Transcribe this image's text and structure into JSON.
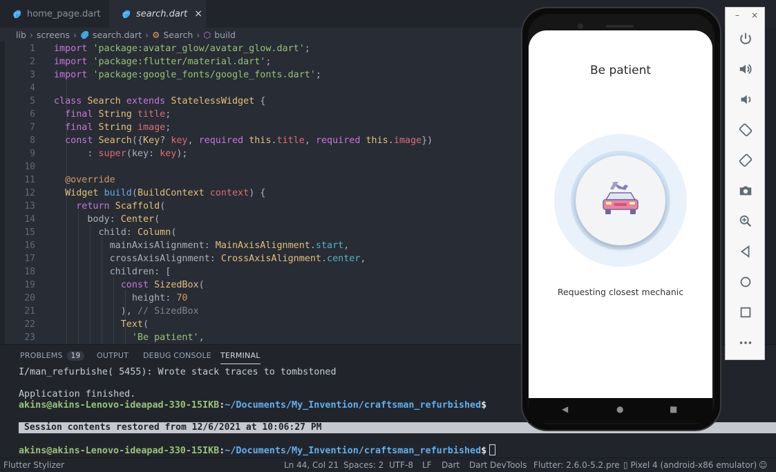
{
  "tabs": [
    {
      "label": "home_page.dart",
      "active": false
    },
    {
      "label": "search.dart",
      "active": true,
      "close": "×"
    }
  ],
  "breadcrumb": [
    "lib",
    "screens",
    "search.dart",
    "Search",
    "build"
  ],
  "code_lines": [
    {
      "n": "1"
    },
    {
      "n": "2"
    },
    {
      "n": "3"
    },
    {
      "n": "4"
    },
    {
      "n": "5"
    },
    {
      "n": "6"
    },
    {
      "n": "7"
    },
    {
      "n": "8"
    },
    {
      "n": "9"
    },
    {
      "n": "10"
    },
    {
      "n": "11"
    },
    {
      "n": "12"
    },
    {
      "n": "13"
    },
    {
      "n": "14"
    },
    {
      "n": "15"
    },
    {
      "n": "16"
    },
    {
      "n": "17"
    },
    {
      "n": "18"
    },
    {
      "n": "19"
    },
    {
      "n": "20"
    },
    {
      "n": "21"
    },
    {
      "n": "22"
    },
    {
      "n": "23"
    }
  ],
  "code": {
    "l1": [
      "import ",
      "'package:avatar_glow/avatar_glow.dart'",
      ";"
    ],
    "l2": [
      "import ",
      "'package:flutter/material.dart'",
      ";"
    ],
    "l3": [
      "import ",
      "'package:google_fonts/google_fonts.dart'",
      ";"
    ],
    "l5": [
      "class ",
      "Search ",
      "extends ",
      "StatelessWidget",
      " {"
    ],
    "l6": [
      "  final ",
      "String ",
      "title",
      ";"
    ],
    "l7": [
      "  final ",
      "String ",
      "image",
      ";"
    ],
    "l8": [
      "  const ",
      "Search",
      "({",
      "Key",
      "? ",
      "key",
      ", ",
      "required ",
      "this",
      ".",
      "title",
      ", ",
      "required ",
      "this",
      ".",
      "image",
      "})"
    ],
    "l9": [
      "      : ",
      "super",
      "(key: ",
      "key",
      ");"
    ],
    "l11": [
      "  @override"
    ],
    "l12": [
      "  ",
      "Widget ",
      "build",
      "(",
      "BuildContext ",
      "context",
      ") {"
    ],
    "l13": [
      "    return ",
      "Scaffold",
      "("
    ],
    "l14": [
      "      body: ",
      "Center",
      "("
    ],
    "l15": [
      "        child: ",
      "Column",
      "("
    ],
    "l16": [
      "          mainAxisAlignment: ",
      "MainAxisAlignment",
      ".",
      "start",
      ","
    ],
    "l17": [
      "          crossAxisAlignment: ",
      "CrossAxisAlignment",
      ".",
      "center",
      ","
    ],
    "l18": [
      "          children: ["
    ],
    "l19": [
      "            const ",
      "SizedBox",
      "("
    ],
    "l20": [
      "              height: ",
      "70"
    ],
    "l21": [
      "            ), ",
      "// SizedBox"
    ],
    "l22": [
      "            ",
      "Text",
      "("
    ],
    "l23": [
      "              ",
      "'Be patient'",
      ","
    ]
  },
  "panel": {
    "tabs": [
      "PROBLEMS",
      "OUTPUT",
      "DEBUG CONSOLE",
      "TERMINAL"
    ],
    "problems_count": "19",
    "term_line1": "I/man_refurbishe( 5455): Wrote stack traces to tombstoned",
    "term_line2": "Application finished.",
    "prompt_user": "akins@akins-Lenovo-ideapad-330-15IKB",
    "prompt_colon": ":",
    "prompt_path": "~/Documents/My_Invention/craftsman_refurbished",
    "prompt_dollar": "$",
    "restore": "Session contents restored from 12/6/2021 at 10:06:27 PM"
  },
  "status": {
    "left": "Flutter Stylizer",
    "ln_col": "Ln 44, Col 21",
    "spaces": "Spaces: 2",
    "encoding": "UTF-8",
    "eol": "LF",
    "lang": "Dart",
    "devtools": "Dart DevTools",
    "flutter": "Flutter: 2.6.0-5.2.pre",
    "device": "Pixel 4 (android-x86 emulator)"
  },
  "phone": {
    "title": "Be patient",
    "subtitle": "Requesting closest mechanic"
  },
  "emulator_toolbar": {
    "minimize": "–",
    "close": "×",
    "icons": [
      "power-icon",
      "volume-up-icon",
      "volume-down-icon",
      "rotate-left-icon",
      "rotate-right-icon",
      "camera-icon",
      "zoom-icon",
      "back-icon",
      "home-icon",
      "overview-icon",
      "more-icon"
    ]
  },
  "colors": {
    "editor_bg": "#282c34",
    "keyword": "#c678dd",
    "string": "#98c379",
    "class": "#e5c07b",
    "function": "#61afef",
    "variable": "#e06c75"
  }
}
